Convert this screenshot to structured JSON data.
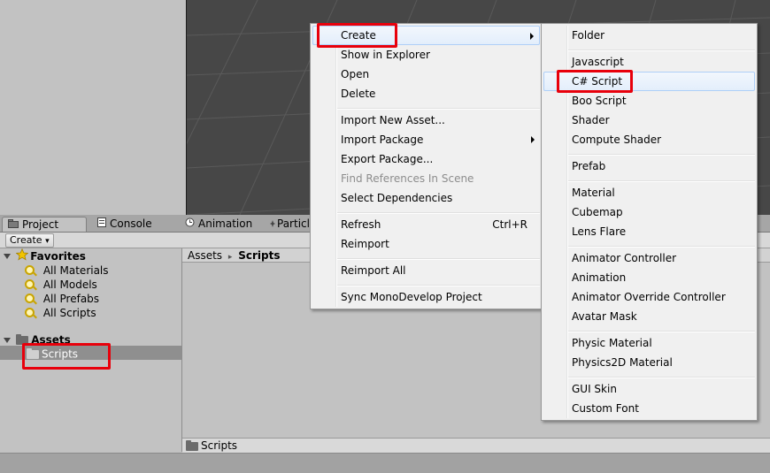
{
  "tabs": [
    {
      "label": "Project",
      "icon": "project-icon",
      "active": true
    },
    {
      "label": "Console",
      "icon": "console-icon",
      "active": false
    },
    {
      "label": "Animation",
      "icon": "animation-clock-icon",
      "active": false
    },
    {
      "label": "Particl",
      "icon": "particle-icon",
      "active": false
    }
  ],
  "toolbar": {
    "create_label": "Create",
    "create_arrow": "▾"
  },
  "tree": {
    "favorites_label": "Favorites",
    "favorites": [
      "All Materials",
      "All Models",
      "All Prefabs",
      "All Scripts"
    ],
    "assets_label": "Assets",
    "selected_folder": "Scripts"
  },
  "breadcrumb": {
    "root": "Assets",
    "separator": "▸",
    "current": "Scripts"
  },
  "path_bar": {
    "label": "Scripts"
  },
  "context_menu": [
    {
      "label": "Create",
      "submenu": true,
      "hover": true
    },
    {
      "label": "Show in Explorer"
    },
    {
      "label": "Open"
    },
    {
      "label": "Delete"
    },
    {
      "label": "Import New Asset..."
    },
    {
      "label": "Import Package",
      "submenu": true
    },
    {
      "label": "Export Package..."
    },
    {
      "label": "Find References In Scene",
      "disabled": true
    },
    {
      "label": "Select Dependencies"
    },
    {
      "label": "Refresh",
      "shortcut": "Ctrl+R"
    },
    {
      "label": "Reimport"
    },
    {
      "label": "Reimport All"
    },
    {
      "label": "Sync MonoDevelop Project"
    }
  ],
  "create_submenu": [
    {
      "label": "Folder"
    },
    {
      "label": "Javascript"
    },
    {
      "label": "C# Script",
      "hover": true
    },
    {
      "label": "Boo Script"
    },
    {
      "label": "Shader"
    },
    {
      "label": "Compute Shader"
    },
    {
      "label": "Prefab"
    },
    {
      "label": "Material"
    },
    {
      "label": "Cubemap"
    },
    {
      "label": "Lens Flare"
    },
    {
      "label": "Animator Controller"
    },
    {
      "label": "Animation"
    },
    {
      "label": "Animator Override Controller"
    },
    {
      "label": "Avatar Mask"
    },
    {
      "label": "Physic Material"
    },
    {
      "label": "Physics2D Material"
    },
    {
      "label": "GUI Skin"
    },
    {
      "label": "Custom Font"
    }
  ],
  "colors": {
    "highlight": "#e8000b",
    "scene_bg": "#474747",
    "panel_bg": "#c2c2c2"
  }
}
